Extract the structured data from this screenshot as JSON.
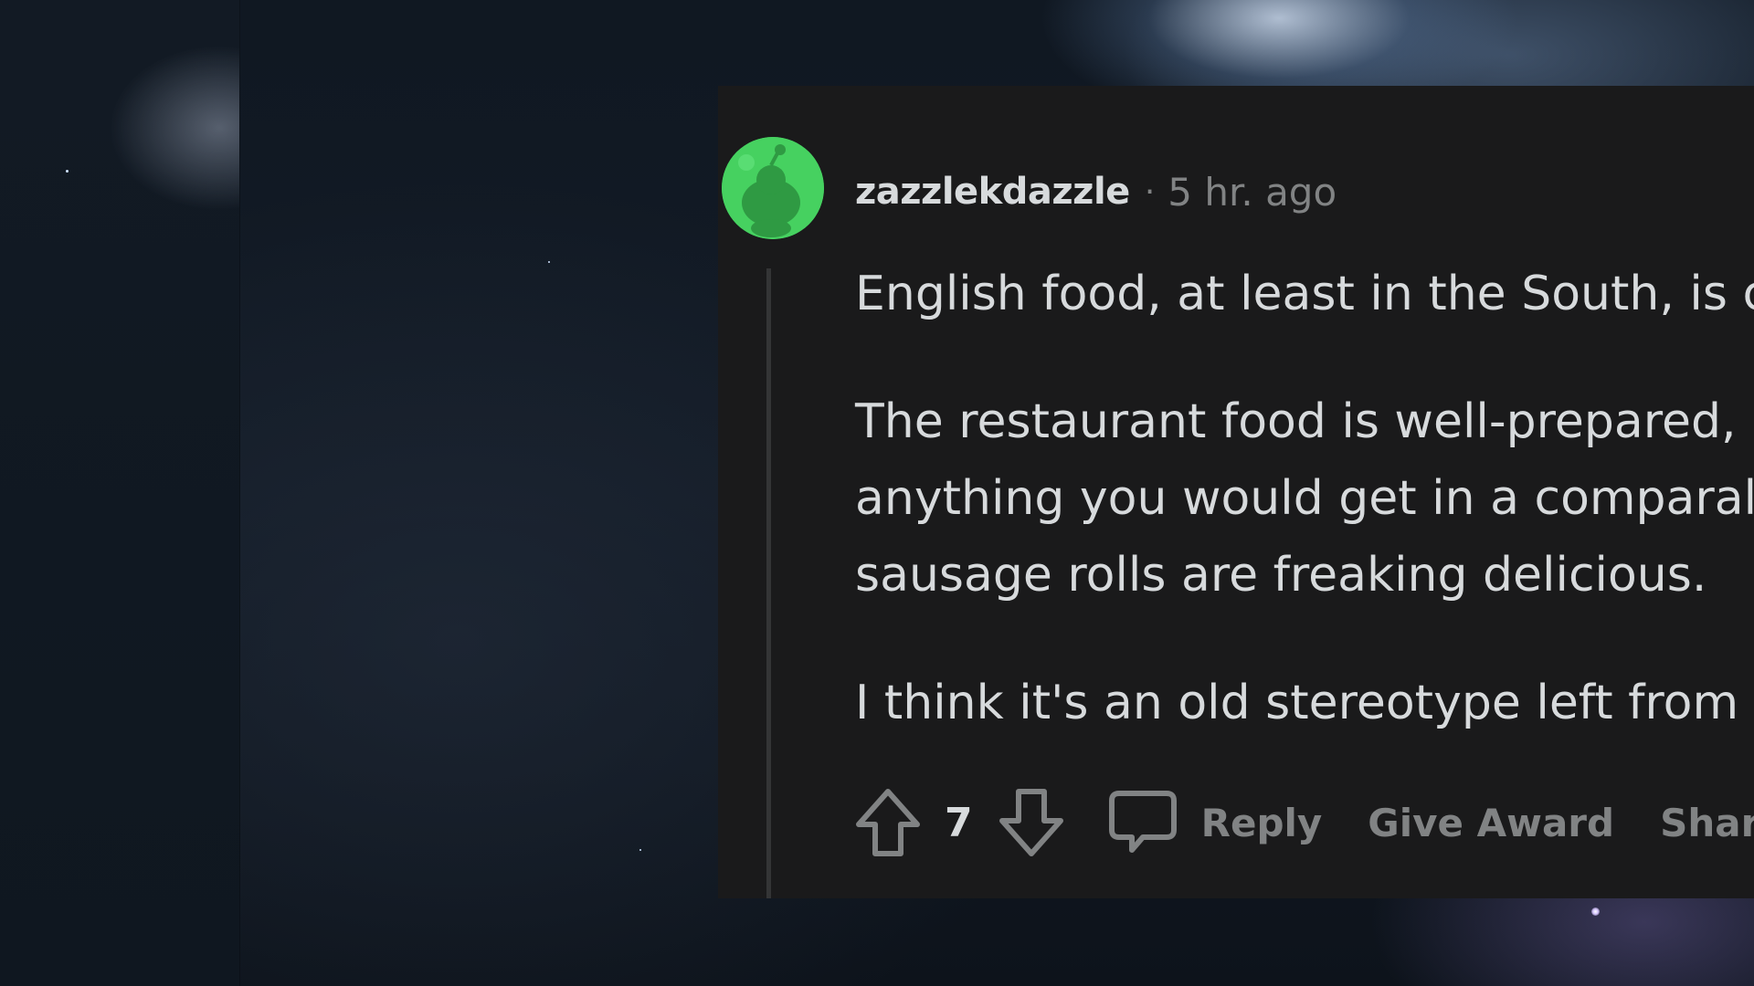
{
  "comment": {
    "author": "zazzlekdazzle",
    "separator": "·",
    "timestamp": "5 hr. ago",
    "paragraphs": [
      [
        "English food, at least in the South, is c"
      ],
      [
        "The restaurant food is well-prepared,",
        "anything you would get in a comparal",
        "sausage rolls are freaking delicious."
      ],
      [
        "I think it's an old stereotype left from"
      ]
    ],
    "vote_count": "7",
    "actions": {
      "reply": "Reply",
      "give_award": "Give Award",
      "share": "Share"
    }
  },
  "colors": {
    "card_background": "#1a1a1b",
    "avatar_background": "#46d160",
    "primary_text": "#d7dadc",
    "muted_text": "#818384",
    "thread_line": "#343536"
  },
  "icons": {
    "upvote": "arrow-up-outline-icon",
    "downvote": "arrow-down-outline-icon",
    "reply": "speech-bubble-icon",
    "avatar": "snoo-avatar-icon"
  }
}
